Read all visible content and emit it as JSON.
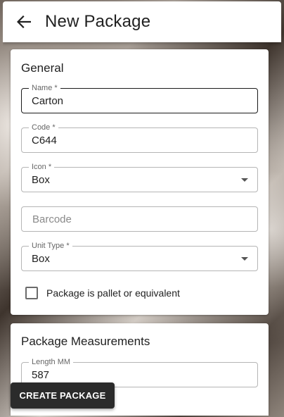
{
  "appbar": {
    "back_icon": "arrow-left-icon",
    "title": "New Package"
  },
  "general": {
    "title": "General",
    "name": {
      "label": "Name *",
      "value": "Carton"
    },
    "code": {
      "label": "Code *",
      "value": "C644"
    },
    "icon": {
      "label": "Icon *",
      "value": "Box"
    },
    "barcode": {
      "placeholder": "Barcode",
      "value": ""
    },
    "unit_type": {
      "label": "Unit Type *",
      "value": "Box"
    },
    "pallet_checkbox": {
      "label": "Package is pallet or equivalent",
      "checked": false
    }
  },
  "measurements": {
    "title": "Package Measurements",
    "length": {
      "label": "Length MM",
      "value": "587"
    }
  },
  "actions": {
    "create_label": "CREATE PACKAGE"
  },
  "colors": {
    "primary_button": "#2b2b2b",
    "focused_border": "#1a1a1a"
  }
}
